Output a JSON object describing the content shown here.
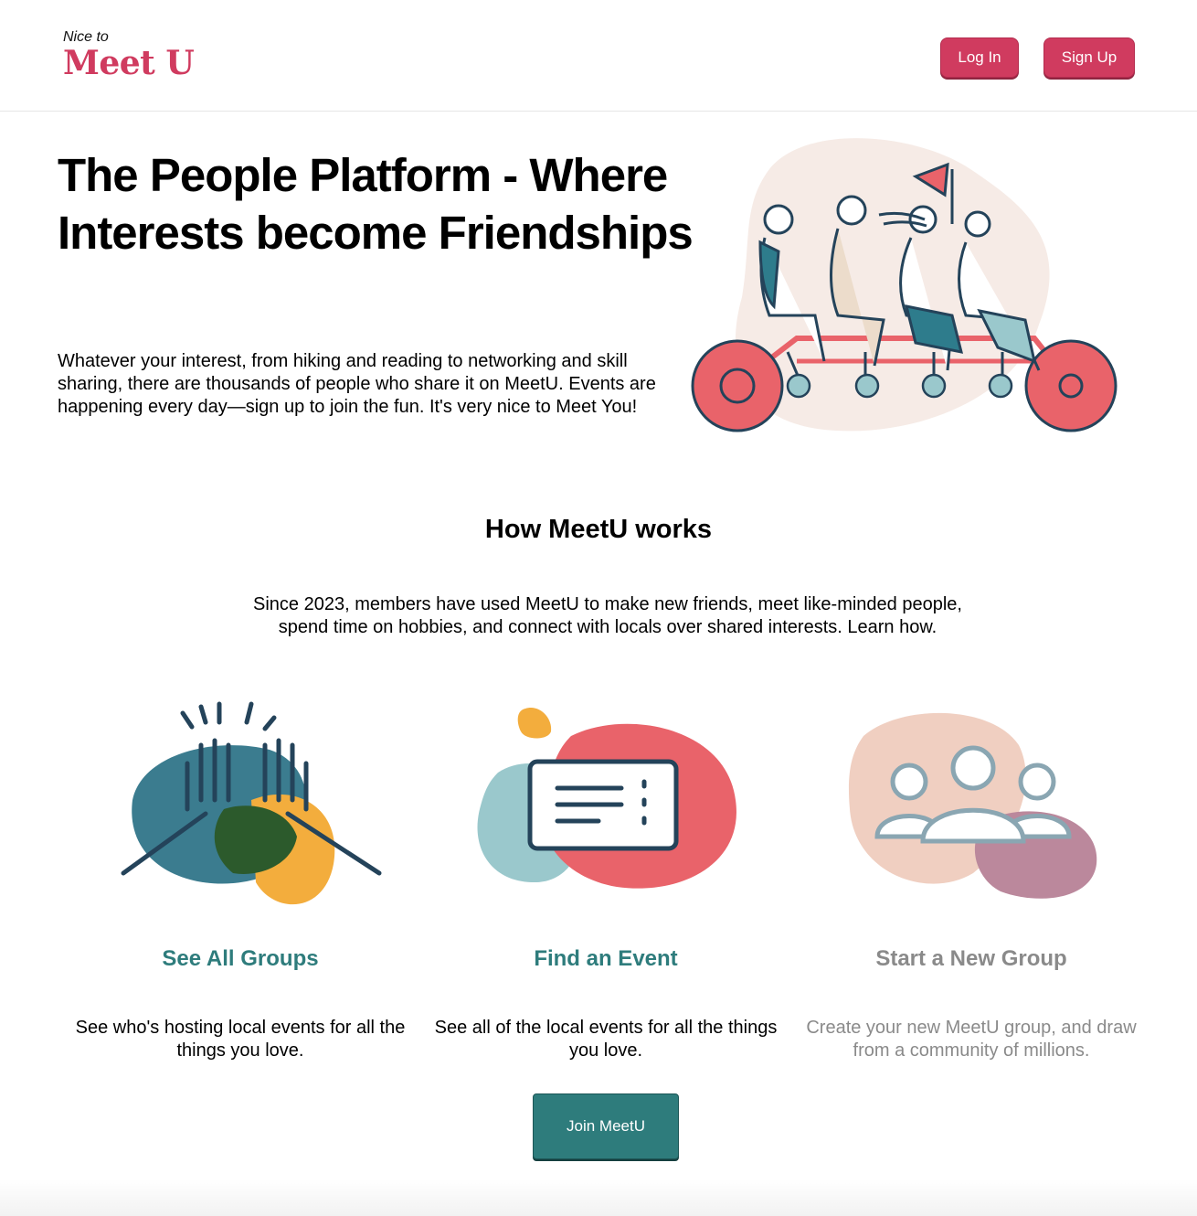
{
  "header": {
    "logo_small": "Nice to",
    "logo_big": "Meet U",
    "login_label": "Log In",
    "signup_label": "Sign Up"
  },
  "hero": {
    "title": "The People Platform - Where Interests become Friendships",
    "text": "Whatever your interest, from hiking and reading to networking and skill sharing, there are thousands of people who share it on MeetU. Events are happening every day—sign up to join the fun. It's very nice to Meet You!"
  },
  "how": {
    "title": "How MeetU works",
    "text": "Since 2023, members have used MeetU to make new friends, meet like-minded people, spend time on hobbies, and connect with locals over shared interests. Learn how."
  },
  "cards": [
    {
      "title": "See All Groups",
      "text": "See who's hosting local events for all the things you love."
    },
    {
      "title": "Find an Event",
      "text": "See all of the local events for all the things you love."
    },
    {
      "title": "Start a New Group",
      "text": "Create your new MeetU group, and draw from a community of millions."
    }
  ],
  "join_label": "Join MeetU",
  "colors": {
    "brand": "#d03b5f",
    "teal": "#2e7c7c",
    "disabled": "#8a8a8a"
  }
}
